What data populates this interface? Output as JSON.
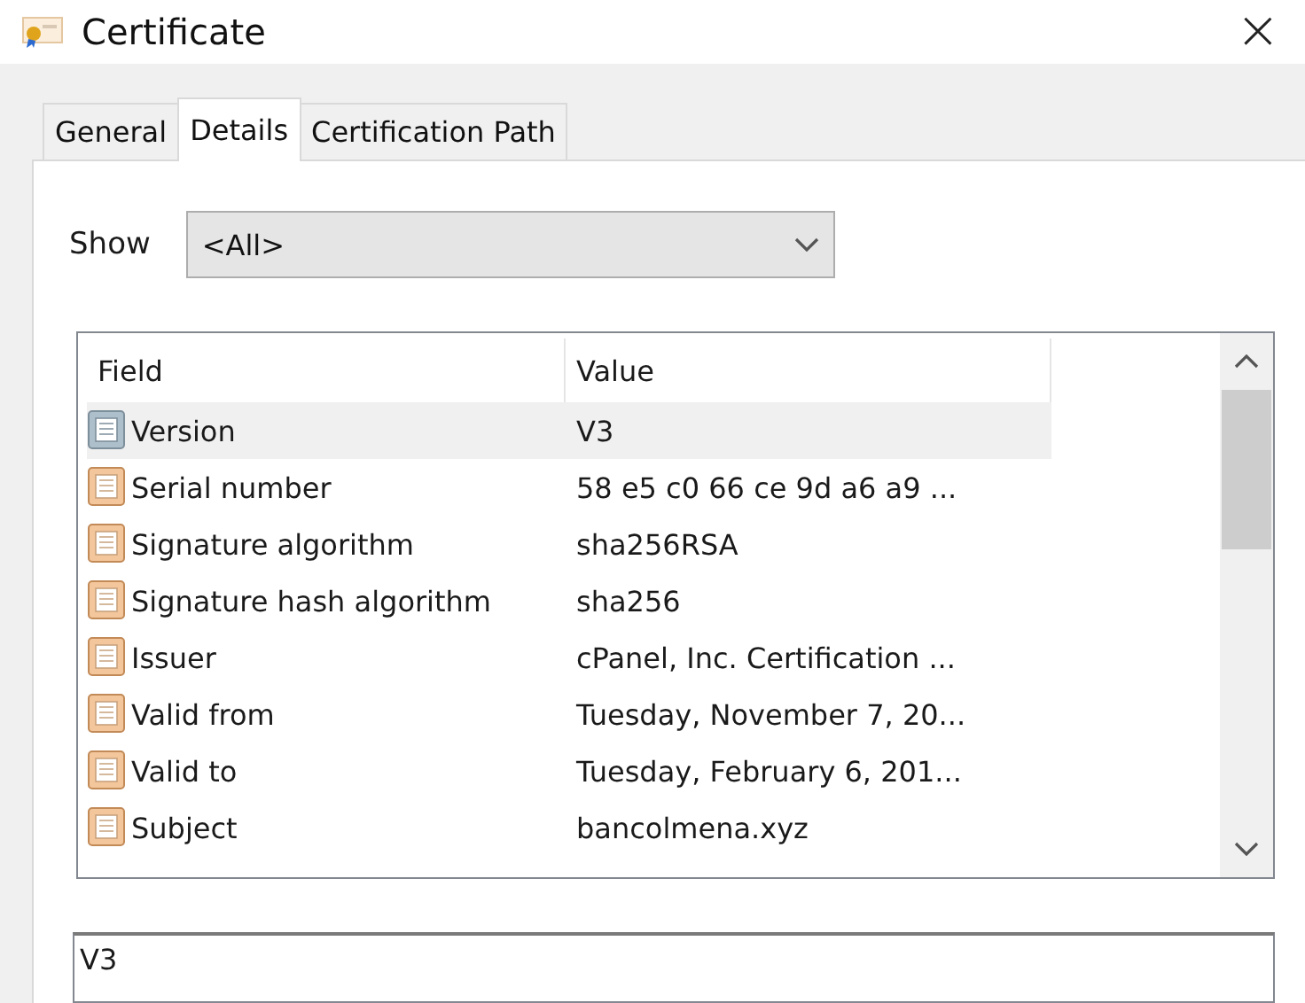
{
  "window": {
    "title": "Certificate",
    "close": "×"
  },
  "tabs": [
    {
      "label": "General",
      "selected": false
    },
    {
      "label": "Details",
      "selected": true
    },
    {
      "label": "Certification Path",
      "selected": false
    }
  ],
  "show": {
    "label": "Show",
    "value": "<All>"
  },
  "table": {
    "columns": [
      "Field",
      "Value"
    ],
    "rows": [
      {
        "field": "Version",
        "value": "V3",
        "selected": true
      },
      {
        "field": "Serial number",
        "value": "58 e5 c0 66 ce 9d a6 a9 ...",
        "selected": false
      },
      {
        "field": "Signature algorithm",
        "value": "sha256RSA",
        "selected": false
      },
      {
        "field": "Signature hash algorithm",
        "value": "sha256",
        "selected": false
      },
      {
        "field": "Issuer",
        "value": "cPanel, Inc. Certification ...",
        "selected": false
      },
      {
        "field": "Valid from",
        "value": "Tuesday, November 7, 20...",
        "selected": false
      },
      {
        "field": "Valid to",
        "value": "Tuesday, February 6, 201...",
        "selected": false
      },
      {
        "field": "Subject",
        "value": "bancolmena.xyz",
        "selected": false
      }
    ]
  },
  "detail": {
    "value": "V3"
  }
}
